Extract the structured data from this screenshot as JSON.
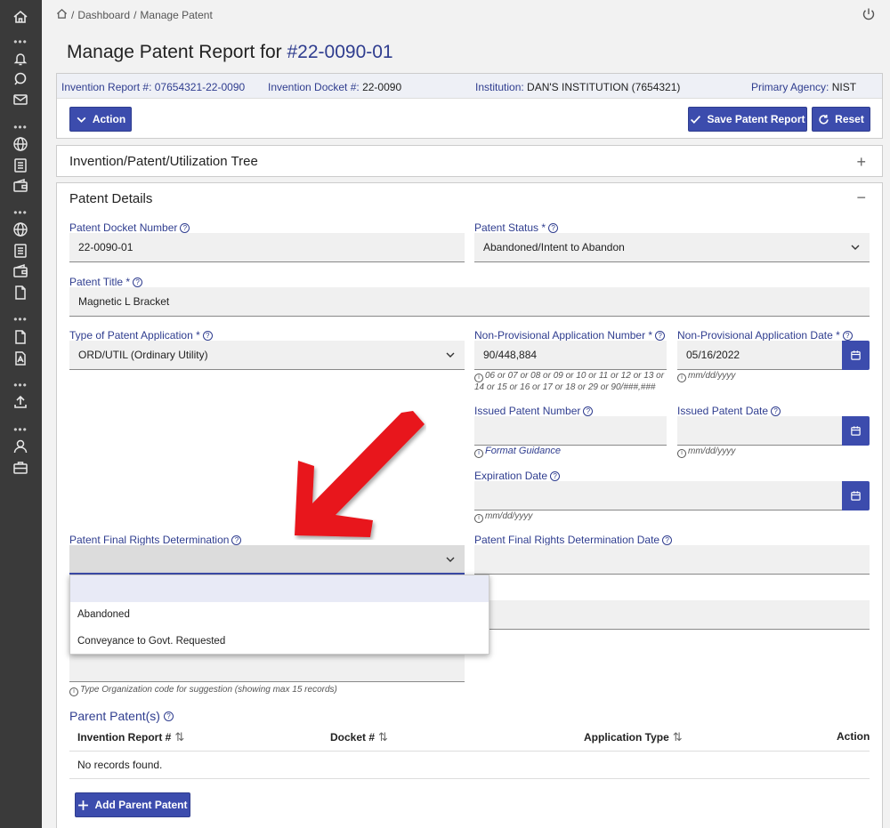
{
  "breadcrumb": {
    "home": "Dashboard",
    "current": "Manage Patent",
    "sep": "/"
  },
  "page_title": {
    "prefix": "Manage Patent Report for",
    "number": "#22-0090-01"
  },
  "info_bar": {
    "invention_report": {
      "label": "Invention Report #:",
      "value": "07654321-22-0090"
    },
    "invention_docket": {
      "label": "Invention Docket #:",
      "value": "22-0090"
    },
    "institution": {
      "label": "Institution:",
      "value": "DAN'S INSTITUTION (7654321)"
    },
    "primary_agency": {
      "label": "Primary Agency:",
      "value": "NIST"
    }
  },
  "toolbar": {
    "action": "Action",
    "save": "Save Patent Report",
    "reset": "Reset"
  },
  "tree": {
    "title": "Invention/Patent/Utilization Tree",
    "toggle": "+"
  },
  "details": {
    "title": "Patent Details",
    "toggle": "−",
    "docket_number": {
      "label": "Patent Docket Number",
      "value": "22-0090-01"
    },
    "status": {
      "label": "Patent Status *",
      "value": "Abandoned/Intent to Abandon"
    },
    "title_field": {
      "label": "Patent Title *",
      "value": "Magnetic L Bracket"
    },
    "type": {
      "label": "Type of Patent Application *",
      "value": "ORD/UTIL (Ordinary Utility)"
    },
    "np_app_number": {
      "label": "Non-Provisional Application Number *",
      "value": "90/448,884",
      "hint_line1": "06 or 07 or 08 or 09 or 10 or 11 or 12 or 13 or",
      "hint_line2": "14 or 15 or 16 or 17 or 18 or 29 or 90/###,###"
    },
    "np_app_date": {
      "label": "Non-Provisional Application Date *",
      "value": "05/16/2022",
      "hint": "mm/dd/yyyy"
    },
    "issued_number": {
      "label": "Issued Patent Number",
      "value": "",
      "hint": "Format Guidance"
    },
    "issued_date": {
      "label": "Issued Patent Date",
      "value": "",
      "hint": "mm/dd/yyyy"
    },
    "expiration_date": {
      "label": "Expiration Date",
      "value": "",
      "hint": "mm/dd/yyyy"
    },
    "final_rights": {
      "label": "Patent Final Rights Determination",
      "value": "",
      "options": [
        "",
        "Abandoned",
        "Conveyance to Govt. Requested"
      ]
    },
    "final_rights_date": {
      "label": "Patent Final Rights Determination Date",
      "value": ""
    },
    "org_hint": "Type Organization code for suggestion (showing max 15 records)"
  },
  "parent_patents": {
    "title": "Parent Patent(s)",
    "columns": [
      "Invention Report #",
      "Docket #",
      "Application Type",
      "Action"
    ],
    "sort_glyph": "⇅",
    "empty": "No records found.",
    "add_button": "Add Parent Patent"
  },
  "colors": {
    "primary": "#3c4cad",
    "link": "#2f3d8f",
    "annotation_arrow": "#e8141b",
    "sidebar": "#3a3a3a"
  }
}
